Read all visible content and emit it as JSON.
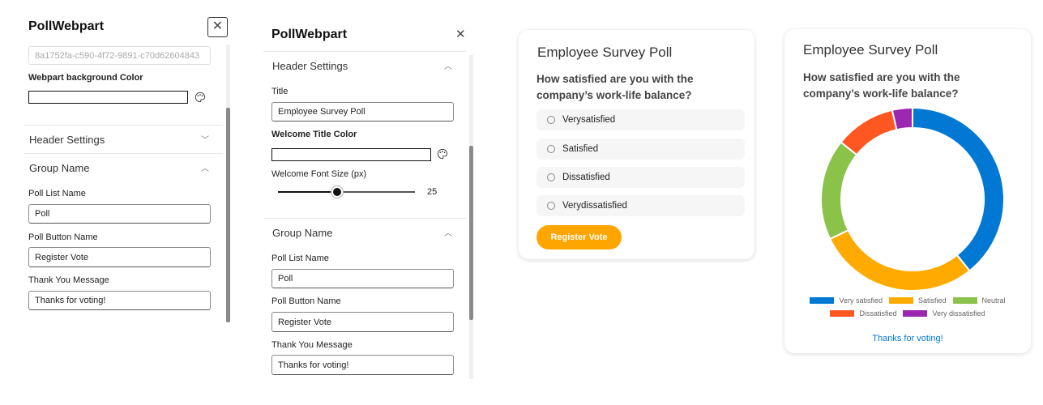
{
  "panel1": {
    "title": "PollWebpart",
    "guid": "8a1752fa-c590-4f72-9891-c70d62604843",
    "bg_color_label": "Webpart background Color",
    "header_settings": "Header Settings",
    "group_name": "Group Name",
    "poll_list_label": "Poll List Name",
    "poll_list_value": "Poll",
    "poll_button_label": "Poll Button Name",
    "poll_button_value": "Register Vote",
    "thank_label": "Thank You Message",
    "thank_value": "Thanks for voting!"
  },
  "panel2": {
    "title": "PollWebpart",
    "header_settings": "Header Settings",
    "title_label": "Title",
    "title_value": "Employee Survey Poll",
    "title_color_label": "Welcome Title Color",
    "font_size_label": "Welcome Font Size (px)",
    "font_size_value": "25",
    "font_size_fraction": 0.43,
    "group_name": "Group Name",
    "poll_list_label": "Poll List Name",
    "poll_list_value": "Poll",
    "poll_button_label": "Poll Button Name",
    "poll_button_value": "Register Vote",
    "thank_label": "Thank You Message",
    "thank_value": "Thanks for voting!"
  },
  "poll": {
    "title": "Employee Survey Poll",
    "question": "How satisfied are you with the company’s work-life balance?",
    "options": [
      "Verysatisfied",
      "Satisfied",
      "Dissatisfied",
      "Verydissatisfied"
    ],
    "button": "Register Vote",
    "accent": "#FFA500"
  },
  "results": {
    "title": "Employee Survey Poll",
    "question": "How satisfied are you with the company’s work-life balance?",
    "thanks": "Thanks for voting!"
  },
  "chart_data": {
    "type": "pie",
    "donut": true,
    "categories": [
      "Very satisfied",
      "Satisfied",
      "Neutral",
      "Dissatisfied",
      "Very dissatisfied"
    ],
    "values": [
      11,
      8,
      5,
      3,
      1
    ],
    "colors": [
      "#0078D4",
      "#FFAA00",
      "#8BC34A",
      "#FF5722",
      "#9C27B0"
    ],
    "legend": "bottom"
  }
}
